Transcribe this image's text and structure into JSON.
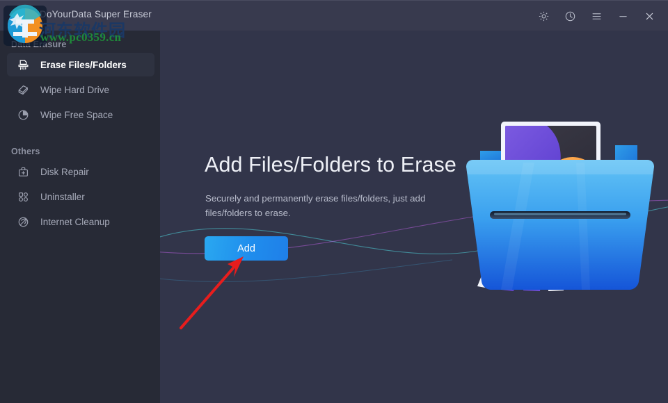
{
  "window": {
    "title": "DoYourData Super Eraser",
    "controls": [
      {
        "name": "settings",
        "icon": "gear-icon"
      },
      {
        "name": "history",
        "icon": "clock-icon"
      },
      {
        "name": "menu",
        "icon": "hamburger-menu-icon"
      },
      {
        "name": "minimize",
        "icon": "minimize-icon"
      },
      {
        "name": "close",
        "icon": "close-icon"
      }
    ]
  },
  "sidebar": {
    "groups": [
      {
        "title": "Data Erasure",
        "items": [
          {
            "label": "Erase Files/Folders",
            "icon": "shredder-icon",
            "active": true
          },
          {
            "label": "Wipe Hard Drive",
            "icon": "eraser-icon",
            "active": false
          },
          {
            "label": "Wipe Free Space",
            "icon": "pie-chart-icon",
            "active": false
          }
        ]
      },
      {
        "title": "Others",
        "items": [
          {
            "label": "Disk Repair",
            "icon": "toolbox-icon",
            "active": false
          },
          {
            "label": "Uninstaller",
            "icon": "grid-squares-icon",
            "active": false
          },
          {
            "label": "Internet Cleanup",
            "icon": "globe-icon",
            "active": false
          }
        ]
      }
    ]
  },
  "main": {
    "headline": "Add Files/Folders to Erase",
    "subtitle": "Securely and permanently erase files/folders, just add files/folders to erase.",
    "add_button": "Add",
    "illustration": "shredder-folder-illustration"
  },
  "watermark": {
    "cjk_text": "河东软件园",
    "url": "www.pc0359.cn",
    "logo": "circular-site-logo"
  },
  "colors": {
    "titlebar": "#383a4e",
    "sidebar": "#272a36",
    "main_bg": "#32354a",
    "sidebar_active": "#2e3240",
    "accent_blue": "#1f8ded",
    "text_primary": "#eef0f6",
    "text_secondary": "#b9bdcc",
    "text_muted": "#a7abba",
    "group_title": "#8d91a1",
    "annotation_red": "#e81d1d",
    "watermark_green": "#1f8a3a"
  }
}
